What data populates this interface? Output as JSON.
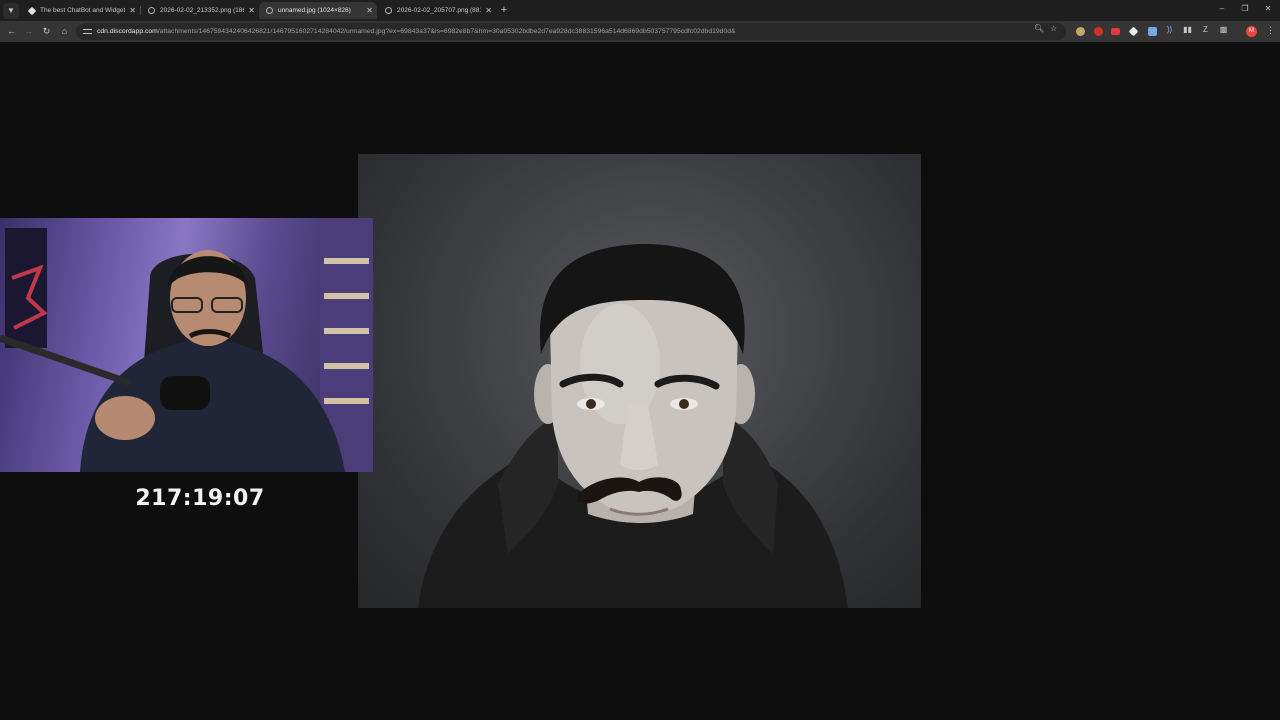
{
  "browser": {
    "tabs": [
      {
        "title": "The best ChatBot and Widget...",
        "favicon": "diamond-icon",
        "active": false
      },
      {
        "title": "2026-02-02_213352.png (1864×...",
        "favicon": "globe-icon",
        "active": false
      },
      {
        "title": "unnamed.jpg (1024×826)",
        "favicon": "globe-icon",
        "active": true
      },
      {
        "title": "2026-02-02_205707.png (881×...",
        "favicon": "globe-icon",
        "active": false
      }
    ],
    "address": {
      "host": "cdn.discordapp.com",
      "path": "/attachments/1467594342406426821/1467951602714284042/unnamed.jpg?ex=69843a37&is=6982e8b7&hm=30a05302bdbe2d7ea928dc38831596a514d6869db503757795cdfc02dbd19d0d&"
    },
    "profile_initial": "M"
  },
  "overlay": {
    "timer": "217:19:07"
  }
}
